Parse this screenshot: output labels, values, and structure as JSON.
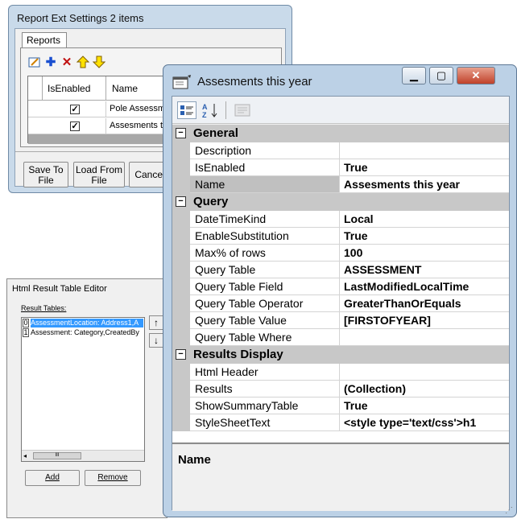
{
  "report_window": {
    "title": "Report Ext Settings 2 items",
    "tab_label": "Reports",
    "columns": [
      "IsEnabled",
      "Name"
    ],
    "rows": [
      {
        "enabled": true,
        "name": "Pole Assessmen"
      },
      {
        "enabled": true,
        "name": "Assesments this"
      }
    ],
    "save_label": "Save To\nFile",
    "load_label": "Load From\nFile",
    "cancel_label": "Cancel"
  },
  "html_editor_window": {
    "title": "Html Result Table Editor",
    "list_label": "Result Tables:",
    "items": [
      {
        "index": "0",
        "text": "AssessmentLocation: Address1,A"
      },
      {
        "index": "1",
        "text": "Assessment: Category,CreatedBy"
      }
    ],
    "scroll_thumb": "III",
    "add_label": "Add",
    "remove_label": "Remove"
  },
  "property_window": {
    "title": "Assesments this year",
    "categories": [
      {
        "name": "General",
        "props": [
          {
            "name": "Description",
            "value": ""
          },
          {
            "name": "IsEnabled",
            "value": "True"
          },
          {
            "name": "Name",
            "value": "Assesments this year",
            "selected": true
          }
        ]
      },
      {
        "name": "Query",
        "props": [
          {
            "name": "DateTimeKind",
            "value": "Local"
          },
          {
            "name": "EnableSubstitution",
            "value": "True"
          },
          {
            "name": "Max% of rows",
            "value": "100"
          },
          {
            "name": "Query Table",
            "value": "ASSESSMENT"
          },
          {
            "name": "Query Table Field",
            "value": "LastModifiedLocalTime"
          },
          {
            "name": "Query Table Operator",
            "value": "GreaterThanOrEquals"
          },
          {
            "name": "Query Table Value",
            "value": "[FIRSTOFYEAR]"
          },
          {
            "name": "Query Table Where",
            "value": ""
          }
        ]
      },
      {
        "name": "Results Display",
        "props": [
          {
            "name": "Html Header",
            "value": ""
          },
          {
            "name": "Results",
            "value": "(Collection)"
          },
          {
            "name": "ShowSummaryTable",
            "value": "True"
          },
          {
            "name": "StyleSheetText",
            "value": "<style type='text/css'>h1"
          }
        ]
      }
    ],
    "help_title": "Name"
  }
}
